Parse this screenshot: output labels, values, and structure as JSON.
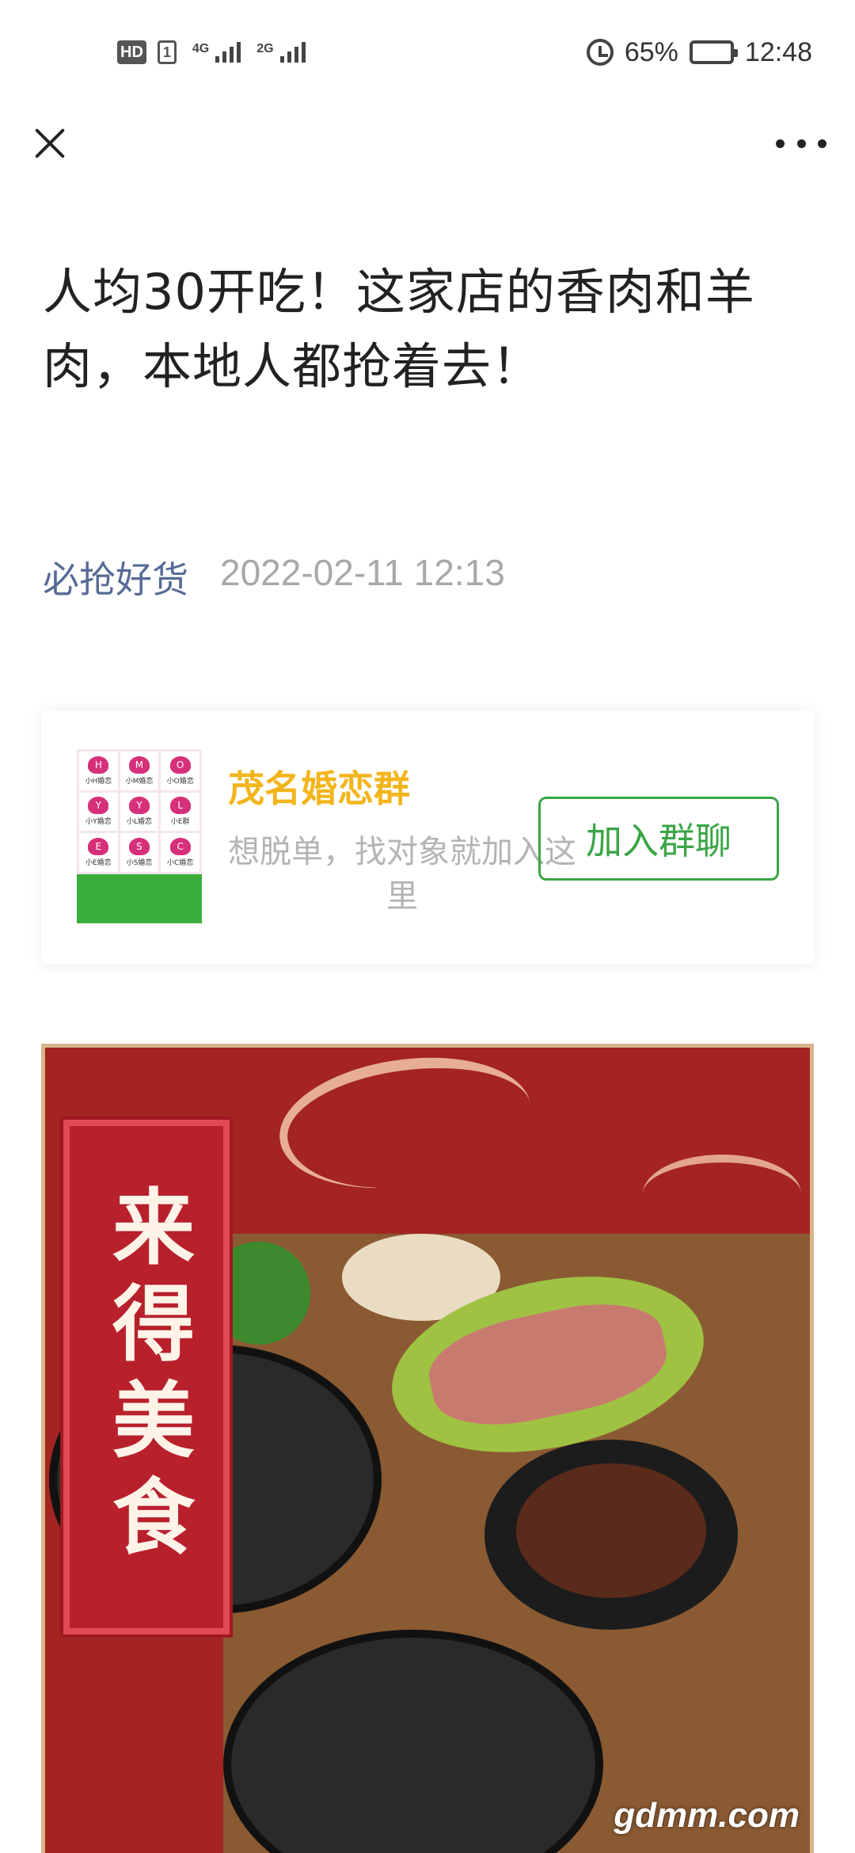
{
  "status_bar": {
    "hd": "HD",
    "sim": "1",
    "net1": "4G",
    "net2": "2G",
    "battery": "65%",
    "time": "12:48",
    "battery_level": 0.65
  },
  "nav": {
    "close_icon": "close-icon",
    "more_icon": "more-icon"
  },
  "article": {
    "title": "人均30开吃！这家店的香肉和羊肉，本地人都抢着去！",
    "account": "必抢好货",
    "publish_time": "2022-02-11 12:13"
  },
  "group_card": {
    "name": "茂名婚恋群",
    "description": "想脱单，找对象就加入这里",
    "join_label": "加入群聊",
    "avatar_cells": [
      {
        "letter": "H",
        "caption": "小H婚恋"
      },
      {
        "letter": "M",
        "caption": "小M婚恋"
      },
      {
        "letter": "O",
        "caption": "小O婚恋"
      },
      {
        "letter": "Y",
        "caption": "小Y婚恋"
      },
      {
        "letter": "Y",
        "caption": "小L婚恋"
      },
      {
        "letter": "L",
        "caption": "小E群"
      },
      {
        "letter": "E",
        "caption": "小E婚恋"
      },
      {
        "letter": "S",
        "caption": "小S婚恋"
      },
      {
        "letter": "C",
        "caption": "小C婚恋"
      }
    ],
    "name_color": "#f2b51c",
    "button_color": "#3aa546"
  },
  "poster": {
    "banner_text": "来得美食",
    "watermark": "gdmm.com",
    "background_color": "#a32420"
  }
}
